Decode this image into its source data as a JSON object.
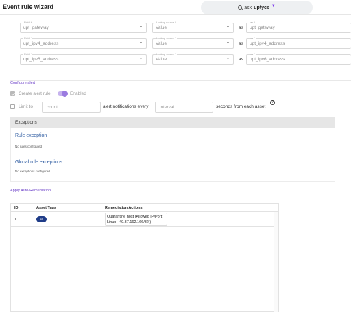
{
  "header": {
    "title": "Event rule wizard",
    "ask_prefix": "ask",
    "ask_brand": "uptycs"
  },
  "mappings": [
    {
      "field_label": "Field *",
      "field_value": "upt_gateway",
      "lookup_label": "Lookup source *",
      "lookup_value": "Value",
      "as_word": "as",
      "as_label": "as *",
      "as_value": "upt_gateway"
    },
    {
      "field_label": "Field *",
      "field_value": "upt_ipv4_address",
      "lookup_label": "Lookup source *",
      "lookup_value": "Value",
      "as_word": "as",
      "as_label": "as *",
      "as_value": "upt_ipv4_address"
    },
    {
      "field_label": "Field *",
      "field_value": "upt_ipv6_address",
      "lookup_label": "Lookup source *",
      "lookup_value": "Value",
      "as_word": "as",
      "as_label": "as *",
      "as_value": "upt_ipv6_address"
    }
  ],
  "configure_alert": {
    "section_title": "Configure alert",
    "create_label": "Create alert rule",
    "create_checked": true,
    "toggle_label": "Enabled",
    "toggle_on": true,
    "limit_label": "Limit to",
    "limit_checked": false,
    "count_placeholder": "count",
    "notif_text": "alert notifications every",
    "interval_placeholder": "interval",
    "seconds_text": "seconds from each asset",
    "help_glyph": "?"
  },
  "exceptions": {
    "header": "Exceptions",
    "rule_title": "Rule exception",
    "rule_note": "No rules configured",
    "global_title": "Global rule exceptions",
    "global_note": "No exceptions configured"
  },
  "remediation": {
    "section_title": "Apply Auto-Remediation",
    "columns": [
      "ID",
      "Asset Tags",
      "Remediation Actions"
    ],
    "rows": [
      {
        "id": "1",
        "tag": "all",
        "action_line1": "Quarantine host (Allowed IP/Port:",
        "action_line2": "Linux - 49.37.162.166/32;)"
      }
    ]
  }
}
